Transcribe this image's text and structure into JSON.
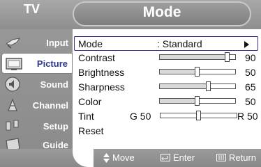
{
  "header": {
    "source_label": "TV",
    "menu_title": "Mode"
  },
  "sidebar": {
    "items": [
      {
        "label": "Input",
        "icon": "input-icon"
      },
      {
        "label": "Picture",
        "icon": "picture-icon",
        "selected": true
      },
      {
        "label": "Sound",
        "icon": "sound-icon"
      },
      {
        "label": "Channel",
        "icon": "channel-icon"
      },
      {
        "label": "Setup",
        "icon": "setup-icon"
      },
      {
        "label": "Guide",
        "icon": "guide-icon"
      }
    ]
  },
  "menu": {
    "mode": {
      "label": "Mode",
      "value": ": Standard"
    },
    "contrast": {
      "label": "Contrast",
      "value": 90
    },
    "brightness": {
      "label": "Brightness",
      "value": 50
    },
    "sharpness": {
      "label": "Sharpness",
      "value": 65
    },
    "color": {
      "label": "Color",
      "value": 50
    },
    "tint": {
      "label": "Tint",
      "left": "G 50",
      "right": "R 50",
      "level": 50
    },
    "reset": {
      "label": "Reset"
    }
  },
  "help_bar": {
    "move": "Move",
    "enter": "Enter",
    "return": "Return"
  },
  "colors": {
    "accent": "#2e3a8c",
    "panel_bg": "#ffffff",
    "chrome": "#9a9a9a"
  }
}
